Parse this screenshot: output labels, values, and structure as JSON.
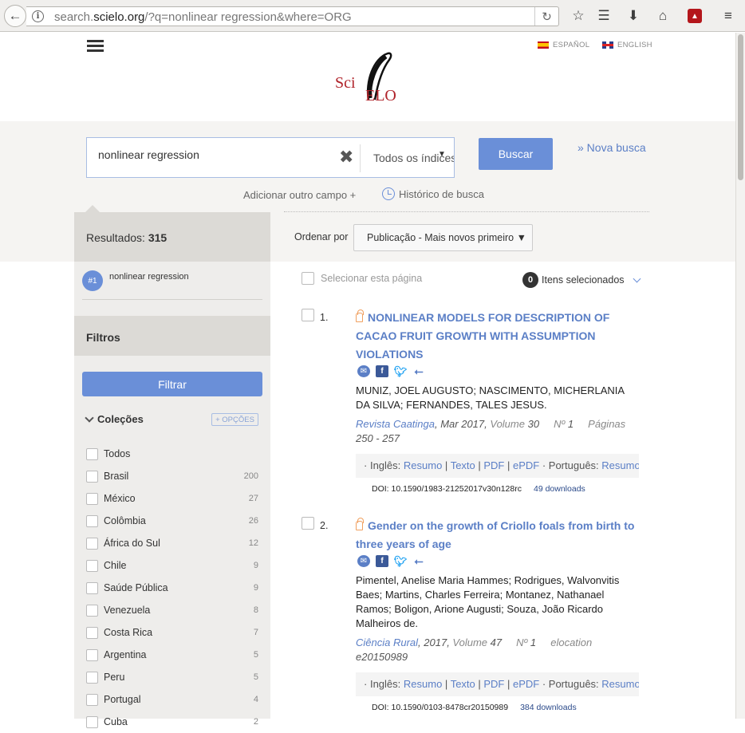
{
  "browser": {
    "url_prefix": "search.",
    "url_domain": "scielo.org",
    "url_rest": "/?q=nonlinear regression&where=ORG"
  },
  "header": {
    "lang_es": "ESPAÑOL",
    "lang_en": "ENGLISH",
    "logo_text_sci": "Sci",
    "logo_text_elo": "ELO"
  },
  "search": {
    "query": "nonlinear regression",
    "field": "Todos os índices",
    "search_button": "Buscar",
    "new_search": "» Nova busca",
    "add_field": "Adicionar outro campo +",
    "history": "Histórico de busca"
  },
  "sidebar": {
    "results_label": "Resultados:",
    "results_count": "315",
    "query_tag": "#1",
    "query_text": "nonlinear regression",
    "filters_title": "Filtros",
    "filter_button": "Filtrar",
    "collections_title": "Coleções",
    "options_button": "+ OPÇÕES",
    "collections": [
      {
        "label": "Todos",
        "count": ""
      },
      {
        "label": "Brasil",
        "count": "200"
      },
      {
        "label": "México",
        "count": "27"
      },
      {
        "label": "Colômbia",
        "count": "26"
      },
      {
        "label": "África do Sul",
        "count": "12"
      },
      {
        "label": "Chile",
        "count": "9"
      },
      {
        "label": "Saúde Pública",
        "count": "9"
      },
      {
        "label": "Venezuela",
        "count": "8"
      },
      {
        "label": "Costa Rica",
        "count": "7"
      },
      {
        "label": "Argentina",
        "count": "5"
      },
      {
        "label": "Peru",
        "count": "5"
      },
      {
        "label": "Portugal",
        "count": "4"
      },
      {
        "label": "Cuba",
        "count": "2"
      }
    ]
  },
  "results": {
    "sort_label": "Ordenar por",
    "sort_value": "Publicação - Mais novos primeiro",
    "select_page": "Selecionar esta página",
    "selected_count": "0",
    "selected_label": "Itens selecionados",
    "articles": [
      {
        "num": "1.",
        "title": "NONLINEAR MODELS FOR DESCRIPTION OF CACAO FRUIT GROWTH WITH ASSUMPTION VIOLATIONS",
        "authors": "MUNIZ, JOEL AUGUSTO; NASCIMENTO, MICHERLANIA DA SILVA; FERNANDES, TALES JESUS.",
        "journal": "Revista Caatinga",
        "date": ", Mar 2017, ",
        "volume_label": "Volume",
        "volume": " 30",
        "num_label": "Nº",
        "issue": " 1",
        "pages_label": "Páginas",
        "pages": "250 - 257",
        "lang1": "Inglês:",
        "lang2": "Português:",
        "link_resumo": "Resumo",
        "link_texto": "Texto",
        "link_pdf": "PDF",
        "link_epdf": "ePDF",
        "doi": "DOI: 10.1590/1983-21252017v30n128rc",
        "downloads": "49 downloads"
      },
      {
        "num": "2.",
        "title": "Gender on the growth of Criollo foals from birth to three years of age",
        "authors": "Pimentel, Anelise Maria Hammes; Rodrigues, Walvonvitis Baes; Martins, Charles Ferreira; Montanez, Nathanael Ramos; Boligon, Arione Augusti; Souza, João Ricardo Malheiros de.",
        "journal": "Ciência Rural",
        "date": ", 2017, ",
        "volume_label": "Volume",
        "volume": " 47",
        "num_label": "Nº",
        "issue": " 1",
        "pages_label": "elocation",
        "pages": "e20150989",
        "lang1": "Inglês:",
        "lang2": "Português:",
        "link_resumo": "Resumo",
        "link_texto": "Texto",
        "link_pdf": "PDF",
        "link_epdf": "ePDF",
        "doi": "DOI: 10.1590/0103-8478cr20150989",
        "downloads": "384 downloads"
      }
    ]
  }
}
